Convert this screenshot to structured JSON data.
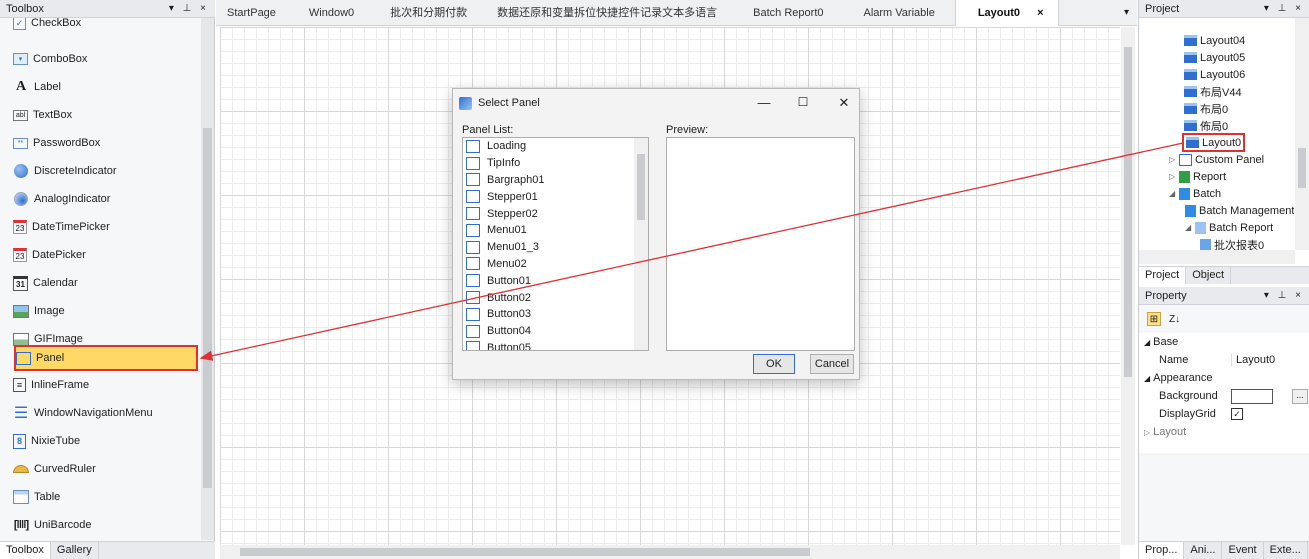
{
  "toolbox": {
    "title": "Toolbox",
    "title_buttons": "▾ ⊥ ×",
    "items": [
      {
        "label": "CheckBox",
        "icon": "checkbox-icon"
      },
      {
        "label": "ComboBox",
        "icon": "combobox-icon"
      },
      {
        "label": "Label",
        "icon": "label-icon"
      },
      {
        "label": "TextBox",
        "icon": "textbox-icon"
      },
      {
        "label": "PasswordBox",
        "icon": "passwordbox-icon"
      },
      {
        "label": "DiscreteIndicator",
        "icon": "discrete-indicator-icon"
      },
      {
        "label": "AnalogIndicator",
        "icon": "analog-indicator-icon"
      },
      {
        "label": "DateTimePicker",
        "icon": "datetimepicker-icon"
      },
      {
        "label": "DatePicker",
        "icon": "datepicker-icon"
      },
      {
        "label": "Calendar",
        "icon": "calendar-icon"
      },
      {
        "label": "Image",
        "icon": "image-icon"
      },
      {
        "label": "GIFImage",
        "icon": "gif-image-icon"
      },
      {
        "label": "Panel",
        "icon": "panel-icon"
      },
      {
        "label": "InlineFrame",
        "icon": "inline-frame-icon"
      },
      {
        "label": "WindowNavigationMenu",
        "icon": "window-navigation-menu-icon"
      },
      {
        "label": "NixieTube",
        "icon": "nixie-tube-icon"
      },
      {
        "label": "CurvedRuler",
        "icon": "curved-ruler-icon"
      },
      {
        "label": "Table",
        "icon": "table-icon"
      },
      {
        "label": "UniBarcode",
        "icon": "barcode-icon"
      }
    ],
    "icon_glyphs": {
      "label": "A",
      "textbox": "abl",
      "calendar": "31",
      "datepicker": "23",
      "datetimepicker": "23"
    },
    "tabs": [
      "Toolbox",
      "Gallery"
    ]
  },
  "documents": {
    "tabs": [
      "StartPage",
      "Window0",
      "批次和分期付款",
      "数据还原和变量拆位快捷控件记录文本多语言",
      "Batch Report0",
      "Alarm Variable",
      "Layout0"
    ],
    "active_tab": "Layout0",
    "close_glyph": "×",
    "dropdown_glyph": "▾"
  },
  "dialog": {
    "title": "Select Panel",
    "panel_list_label": "Panel List:",
    "preview_label": "Preview:",
    "panels": [
      "Loading",
      "TipInfo",
      "Bargraph01",
      "Stepper01",
      "Stepper02",
      "Menu01",
      "Menu01_3",
      "Menu02",
      "Button01",
      "Button02",
      "Button03",
      "Button04",
      "Button05"
    ],
    "ok_label": "OK",
    "cancel_label": "Cancel",
    "minimize_glyph": "—",
    "maximize_glyph": "☐",
    "close_glyph": "✕"
  },
  "project": {
    "title": "Project",
    "title_buttons": "▾ ⊥ ×",
    "tree": [
      {
        "label": "Layout04"
      },
      {
        "label": "Layout05"
      },
      {
        "label": "Layout06"
      },
      {
        "label": "布局V44"
      },
      {
        "label": "布局0"
      },
      {
        "label": "佈局0"
      },
      {
        "label": "Layout0"
      },
      {
        "label": "Custom Panel",
        "expander": "▷"
      },
      {
        "label": "Report",
        "expander": "▷"
      },
      {
        "label": "Batch",
        "expander": "◢"
      },
      {
        "label": "Batch Management"
      },
      {
        "label": "Batch Report",
        "expander": "◢"
      },
      {
        "label": "批次报表0"
      }
    ],
    "tabs": [
      "Project",
      "Object"
    ]
  },
  "property": {
    "title": "Property",
    "title_buttons": "▾ ⊥ ×",
    "sort_categorized_glyph": "⊞",
    "sort_alpha_glyph": "Z↓",
    "groups": {
      "base": "Base",
      "appearance": "Appearance",
      "layout": "Layout"
    },
    "rows": {
      "name": {
        "key": "Name",
        "value": "Layout0"
      },
      "background": {
        "key": "Background",
        "value": "",
        "button": "..."
      },
      "display_grid": {
        "key": "DisplayGrid",
        "value": "✓"
      }
    },
    "tabs": [
      "Prop...",
      "Ani...",
      "Event",
      "Exte..."
    ]
  },
  "colors": {
    "highlight_border": "#e03030",
    "selection_fill": "#ffd966",
    "accent_blue": "#2e6fd1"
  }
}
